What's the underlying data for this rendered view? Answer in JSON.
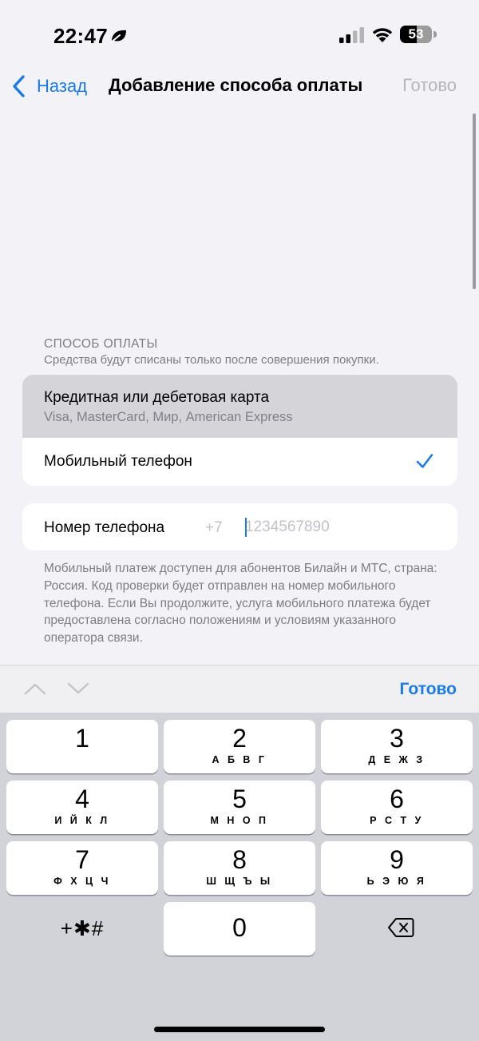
{
  "status_bar": {
    "time": "22:47",
    "battery": "53",
    "battery_level_percent": 53,
    "icons": [
      "leaf-moon-icon",
      "cellular-signal-icon",
      "wifi-icon",
      "battery-icon"
    ]
  },
  "nav": {
    "back_label": "Назад",
    "title": "Добавление способа оплаты",
    "done_label": "Готово",
    "done_color": "#b6b6bb"
  },
  "payment": {
    "header": "СПОСОБ ОПЛАТЫ",
    "subtitle": "Средства будут списаны только после совершения покупки.",
    "options": [
      {
        "title": "Кредитная или дебетовая карта",
        "subtitle": "Visa, MasterCard, Мир, American Express",
        "selected": false
      },
      {
        "title": "Мобильный телефон",
        "selected": true
      }
    ]
  },
  "phone": {
    "label": "Номер телефона",
    "prefix": "+7",
    "value": "",
    "placeholder": "1234567890"
  },
  "footnote": "Мобильный платеж доступен для абонентов Билайн и МТС, страна: Россия. Код проверки будет отправлен на номер мобильного телефона. Если Вы продолжите, услуга мобильного платежа будет предоставлена согласно положениям и условиям указанного оператора связи.",
  "accessory": {
    "done_label": "Готово",
    "icons": [
      "chevron-up-icon",
      "chevron-down-icon"
    ]
  },
  "keypad": {
    "keys": [
      {
        "digit": "1",
        "letters": ""
      },
      {
        "digit": "2",
        "letters": "А Б В Г"
      },
      {
        "digit": "3",
        "letters": "Д Е Ж З"
      },
      {
        "digit": "4",
        "letters": "И Й К Л"
      },
      {
        "digit": "5",
        "letters": "М Н О П"
      },
      {
        "digit": "6",
        "letters": "Р С Т У"
      },
      {
        "digit": "7",
        "letters": "Ф Х Ц Ч"
      },
      {
        "digit": "8",
        "letters": "Ш Щ Ъ Ы"
      },
      {
        "digit": "9",
        "letters": "Ь Э Ю Я"
      }
    ],
    "symbols": "+✱#",
    "zero": "0",
    "delete_icon": "backspace-icon"
  },
  "colors": {
    "accent": "#1a7bea",
    "background": "#f2f2f7",
    "selected_row": "#d4d4d9",
    "keyboard_bg": "#d1d3d9"
  }
}
